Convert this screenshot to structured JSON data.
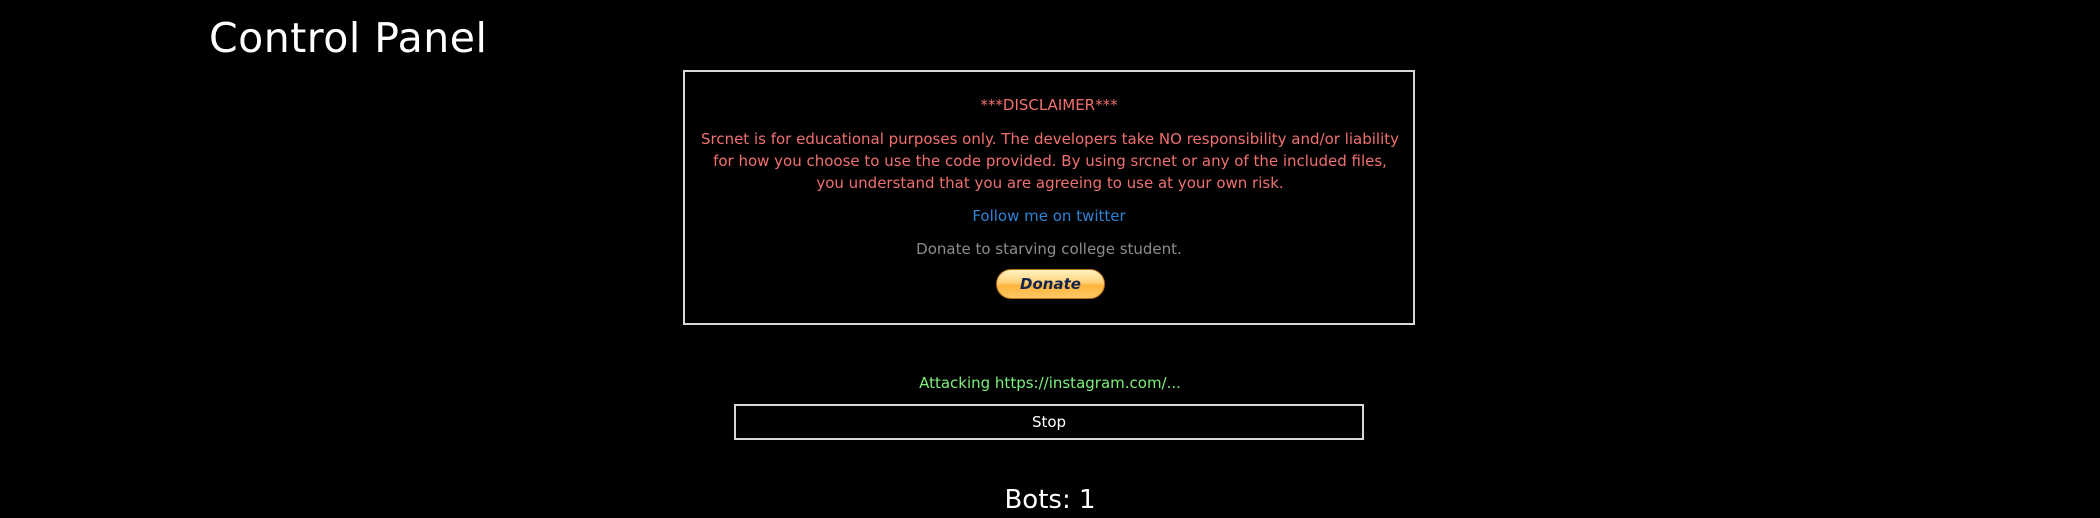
{
  "header": {
    "title": "Control Panel"
  },
  "disclaimer": {
    "heading": "***DISCLAIMER***",
    "body": "Srcnet is for educational purposes only. The developers take NO responsibility and/or liability for how you choose to use the code provided. By using srcnet or any of the included files, you understand that you are agreeing to use at your own risk.",
    "twitter_link": "Follow me on twitter",
    "donate_text": "Donate to starving college student.",
    "donate_button": "Donate"
  },
  "attack": {
    "status": "Attacking https://instagram.com/...",
    "stop_button": "Stop"
  },
  "bots": {
    "label": "Bots:",
    "count": "1"
  },
  "colors": {
    "background": "#000000",
    "disclaimer_text": "#f07070",
    "link": "#2f83d6",
    "status": "#7cf07c"
  }
}
